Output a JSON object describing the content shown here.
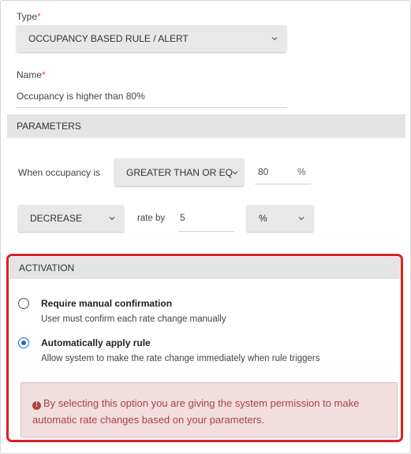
{
  "type_field": {
    "label": "Type",
    "required_mark": "*",
    "value": "OCCUPANCY BASED RULE / ALERT"
  },
  "name_field": {
    "label": "Name",
    "required_mark": "*",
    "value": "Occupancy is higher than 80%"
  },
  "parameters": {
    "section_title": "PARAMETERS",
    "condition_label": "When occupancy is",
    "comparison": "GREATER THAN OR EQ",
    "threshold_value": "80",
    "threshold_unit": "%",
    "direction": "DECREASE",
    "rate_by_label": "rate by",
    "rate_value": "5",
    "rate_unit": "%"
  },
  "activation": {
    "section_title": "ACTIVATION",
    "options": [
      {
        "title": "Require manual confirmation",
        "description": "User must confirm each rate change manually",
        "selected": false
      },
      {
        "title": "Automatically apply rule",
        "description": "Allow system to make the rate change immediately when rule triggers",
        "selected": true
      }
    ],
    "alert_icon": "exclamation-circle-icon",
    "alert_text": "By selecting this option you are giving the system permission to make automatic rate changes based on your parameters."
  },
  "colors": {
    "highlight_border": "#e01e1e",
    "radio_selected": "#1e6fb8",
    "alert_bg": "#f2dede",
    "alert_text": "#a94442"
  }
}
